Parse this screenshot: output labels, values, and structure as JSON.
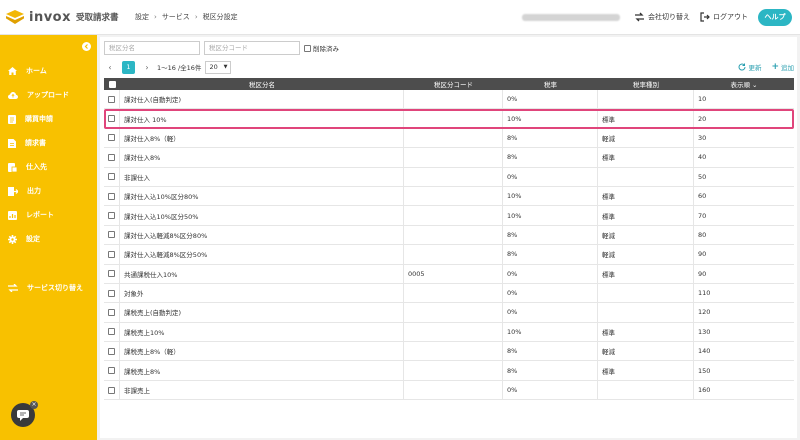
{
  "app": {
    "logo_word": "invox",
    "logo_sub": "受取請求書"
  },
  "breadcrumb": [
    "設定",
    "サービス",
    "税区分設定"
  ],
  "header": {
    "company_switch": "会社切り替え",
    "logout": "ログアウト",
    "help": "ヘルプ"
  },
  "sidebar": {
    "items": [
      {
        "label": "ホーム",
        "icon": "home-icon"
      },
      {
        "label": "アップロード",
        "icon": "cloud-upload-icon"
      },
      {
        "label": "購買申請",
        "icon": "document-icon"
      },
      {
        "label": "請求書",
        "icon": "invoice-icon"
      },
      {
        "label": "仕入先",
        "icon": "supplier-icon"
      },
      {
        "label": "出力",
        "icon": "output-icon"
      },
      {
        "label": "レポート",
        "icon": "report-icon"
      },
      {
        "label": "設定",
        "icon": "gear-icon"
      },
      {
        "label": "サービス切り替え",
        "icon": "switch-icon"
      }
    ]
  },
  "filters": {
    "name_placeholder": "税区分名",
    "code_placeholder": "税区分コード",
    "deleted_label": "削除済み"
  },
  "pager": {
    "current_page": "1",
    "info": "1〜16 /全16件",
    "page_size": "20",
    "refresh": "更新",
    "add": "追加"
  },
  "table": {
    "headers": [
      "税区分名",
      "税区分コード",
      "税率",
      "税率種別",
      "表示順 ⌄"
    ],
    "rows": [
      {
        "name": "課対仕入(自動判定)",
        "code": "",
        "rate": "0%",
        "type": "",
        "order": "10"
      },
      {
        "name": "課対仕入 10%",
        "code": "",
        "rate": "10%",
        "type": "標準",
        "order": "20"
      },
      {
        "name": "課対仕入8%（軽）",
        "code": "",
        "rate": "8%",
        "type": "軽減",
        "order": "30"
      },
      {
        "name": "課対仕入8%",
        "code": "",
        "rate": "8%",
        "type": "標準",
        "order": "40"
      },
      {
        "name": "非課仕入",
        "code": "",
        "rate": "0%",
        "type": "",
        "order": "50"
      },
      {
        "name": "課対仕入込10%区分80%",
        "code": "",
        "rate": "10%",
        "type": "標準",
        "order": "60"
      },
      {
        "name": "課対仕入込10%区分50%",
        "code": "",
        "rate": "10%",
        "type": "標準",
        "order": "70"
      },
      {
        "name": "課対仕入込軽減8%区分80%",
        "code": "",
        "rate": "8%",
        "type": "軽減",
        "order": "80"
      },
      {
        "name": "課対仕入込軽減8%区分50%",
        "code": "",
        "rate": "8%",
        "type": "軽減",
        "order": "90"
      },
      {
        "name": "共通課税仕入10%",
        "code": "0005",
        "rate": "0%",
        "type": "標準",
        "order": "90"
      },
      {
        "name": "対象外",
        "code": "",
        "rate": "0%",
        "type": "",
        "order": "110"
      },
      {
        "name": "課税売上(自動判定)",
        "code": "",
        "rate": "0%",
        "type": "",
        "order": "120"
      },
      {
        "name": "課税売上10%",
        "code": "",
        "rate": "10%",
        "type": "標準",
        "order": "130"
      },
      {
        "name": "課税売上8%（軽）",
        "code": "",
        "rate": "8%",
        "type": "軽減",
        "order": "140"
      },
      {
        "name": "課税売上8%",
        "code": "",
        "rate": "8%",
        "type": "標準",
        "order": "150"
      },
      {
        "name": "非課売上",
        "code": "",
        "rate": "0%",
        "type": "",
        "order": "160"
      }
    ],
    "selected_row": 1
  },
  "colors": {
    "sidebar": "#f8c100",
    "accent": "#2cb6c4",
    "header_row": "#4d4d4d",
    "selection": "#e0457b"
  }
}
